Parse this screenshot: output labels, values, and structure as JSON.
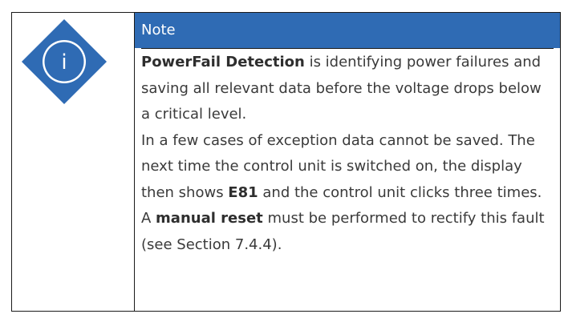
{
  "note": {
    "icon": "info-icon",
    "icon_letter": "i",
    "header": "Note",
    "colors": {
      "header_bg": "#2f6bb4",
      "diamond": "#2f6bb4",
      "text": "#3a3a3a"
    },
    "paragraph1": {
      "bold_lead": "PowerFail Detection",
      "text": " is identifying power failures and saving all relevant data before the voltage drops below a critical level."
    },
    "paragraph2": {
      "text_a": "In a few cases of exception data cannot be saved. The next time the control unit is switched on, the display then shows ",
      "bold_code": "E81",
      "text_b": " and the control unit clicks three times. A ",
      "bold_reset": "manual reset",
      "text_c": " must be performed to rectify this fault (see Section 7.4.4)."
    }
  }
}
